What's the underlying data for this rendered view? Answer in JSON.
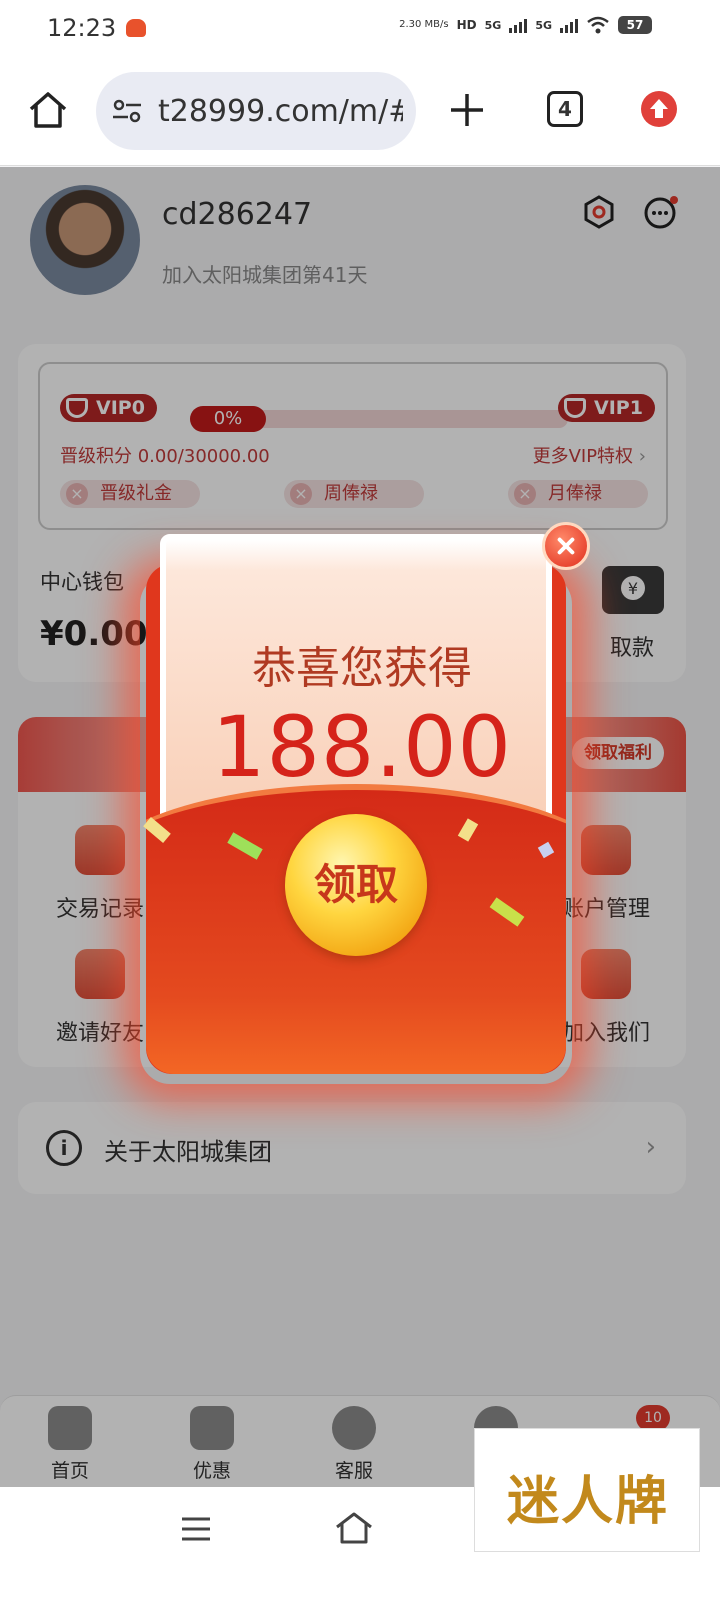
{
  "status_bar": {
    "time": "12:23",
    "net_speed": "2.30 MB/s",
    "hd": "HD",
    "sim1": "5G",
    "sim2": "5G",
    "battery": "57"
  },
  "browser": {
    "url": "t28999.com/m/#/",
    "tab_count": "4"
  },
  "profile": {
    "username": "cd286247",
    "days_joined": "加入太阳城集团第41天"
  },
  "vip": {
    "current_level": "VIP0",
    "next_level": "VIP1",
    "progress_label": "0%",
    "progress_value": 0,
    "points": "晋级积分 0.00/30000.00",
    "more_link": "更多VIP特权",
    "perks": [
      "晋级礼金",
      "周俸禄",
      "月俸禄"
    ]
  },
  "wallet": {
    "label": "中心钱包",
    "amount": "¥0.00",
    "withdraw": "取款"
  },
  "menu": {
    "banner_tag": "领取福利",
    "items": [
      "交易记录",
      "账户管理",
      "邀请好友",
      "加入我们"
    ]
  },
  "about": {
    "label": "关于太阳城集团"
  },
  "tabbar": {
    "items": [
      "首页",
      "优惠",
      "客服"
    ],
    "badge": "10"
  },
  "modal": {
    "congrats": "恭喜您获得",
    "amount": "188.00",
    "claim": "领取"
  },
  "watermark": "迷人牌",
  "colors": {
    "accent_red": "#d5231a",
    "gold": "#ffd640",
    "envelope": "#e0371d"
  }
}
